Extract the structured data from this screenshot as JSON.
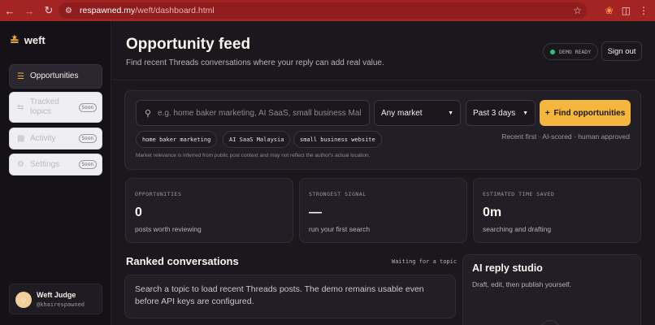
{
  "browser": {
    "url_host": "respawned.my",
    "url_path": "/weft/dashboard.html"
  },
  "brand": {
    "name": "weft",
    "accent": "#f4b63d"
  },
  "sidebar": {
    "items": [
      {
        "label": "Opportunities",
        "icon": "list-icon",
        "badge": ""
      },
      {
        "label": "Tracked topics",
        "icon": "sliders-icon",
        "badge": "Soon"
      },
      {
        "label": "Activity",
        "icon": "bar-chart-icon",
        "badge": "Soon"
      },
      {
        "label": "Settings",
        "icon": "gear-icon",
        "badge": "Soon"
      }
    ],
    "user": {
      "name": "Weft Judge",
      "handle": "@khairespawned"
    }
  },
  "header": {
    "title": "Opportunity feed",
    "subtitle": "Find recent Threads conversations where your reply can add real value.",
    "status": "DEMO READY",
    "status_color": "#34c37a",
    "signout_label": "Sign out"
  },
  "search": {
    "placeholder": "e.g. home baker marketing, AI SaaS, small business Malaysia",
    "market": "Any market",
    "timeframe": "Past 3 days",
    "find_label": "Find opportunities",
    "chips": [
      "home baker marketing",
      "AI SaaS Malaysia",
      "small business website"
    ],
    "sort_note": "Recent first · AI-scored · human approved",
    "disclaimer": "Market relevance is inferred from public post context and may not reflect the author's actual location."
  },
  "stats": [
    {
      "label": "OPPORTUNITIES",
      "value": "0",
      "sub": "posts worth reviewing"
    },
    {
      "label": "STRONGEST SIGNAL",
      "value": "—",
      "sub": "run your first search"
    },
    {
      "label": "ESTIMATED TIME SAVED",
      "value": "0m",
      "sub": "searching and drafting"
    }
  ],
  "ranked": {
    "title": "Ranked conversations",
    "status": "Waiting for a topic",
    "empty": "Search a topic to load recent Threads posts. The demo remains usable even before API keys are configured."
  },
  "studio": {
    "title": "AI reply studio",
    "subtitle": "Draft, edit, then publish yourself."
  }
}
